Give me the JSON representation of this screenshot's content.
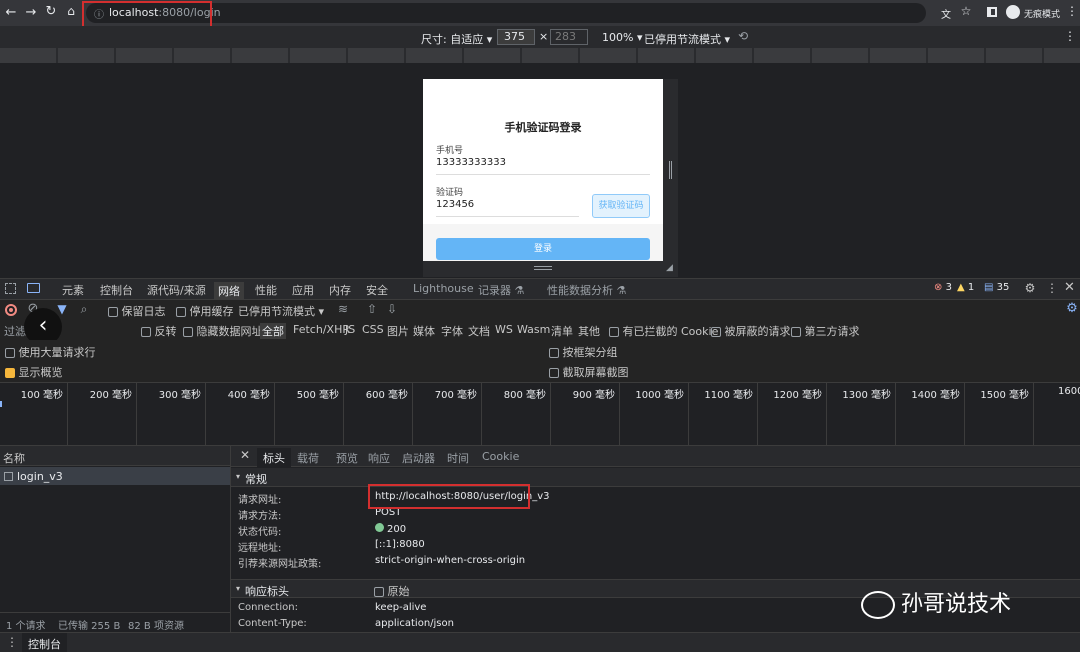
{
  "browser": {
    "url_host": "localhost",
    "url_rest": ":8080/login",
    "profile_label": "无痕模式"
  },
  "device_toolbar": {
    "size_label": "尺寸: 自适应 ▾",
    "width": "375",
    "x": "×",
    "height": "283",
    "zoom": "100% ▾",
    "throttle": "已停用节流模式 ▾"
  },
  "phone": {
    "title": "手机验证码登录",
    "phone_label": "手机号",
    "phone_value": "13333333333",
    "code_label": "验证码",
    "code_value": "123456",
    "code_button": "获取验证码",
    "login_button": "登录"
  },
  "devtools": {
    "tabs": [
      "元素",
      "控制台",
      "源代码/来源",
      "网络",
      "性能",
      "应用",
      "内存",
      "安全",
      "Lighthouse",
      "记录器 ⚗",
      "性能数据分析 ⚗"
    ],
    "active_tab": "网络",
    "errors": "3",
    "warnings": "1",
    "messages": "35"
  },
  "network_toolbar": {
    "preserve_log": "保留日志",
    "disable_cache": "停用缓存",
    "throttle": "已停用节流模式"
  },
  "filter": {
    "placeholder": "过滤",
    "invert": "反转",
    "hide_data": "隐藏数据网址",
    "types": [
      "全部",
      "Fetch/XHR",
      "JS",
      "CSS",
      "图片",
      "媒体",
      "字体",
      "文档",
      "WS",
      "Wasm",
      "清单",
      "其他"
    ],
    "blocked_cookies": "有已拦截的 Cookie",
    "blocked_requests": "被屏蔽的请求",
    "third_party": "第三方请求"
  },
  "options": {
    "big_rows": "使用大量请求行",
    "group_by_frame": "按框架分组",
    "overview": "显示概览",
    "screenshots": "截取屏幕截图"
  },
  "timeline": {
    "ticks": [
      "100 毫秒",
      "200 毫秒",
      "300 毫秒",
      "400 毫秒",
      "500 毫秒",
      "600 毫秒",
      "700 毫秒",
      "800 毫秒",
      "900 毫秒",
      "1000 毫秒",
      "1100 毫秒",
      "1200 毫秒",
      "1300 毫秒",
      "1400 毫秒",
      "1500 毫秒",
      "1600"
    ]
  },
  "request_list": {
    "header": "名称",
    "item": "login_v3",
    "summary_requests": "1 个请求",
    "summary_transferred": "已传输 255 B",
    "summary_resources": "82 B 项资源"
  },
  "details": {
    "tabs": [
      "标头",
      "载荷",
      "预览",
      "响应",
      "启动器",
      "时间",
      "Cookie"
    ],
    "active_tab": "标头",
    "general_title": "常规",
    "general": [
      {
        "label": "请求网址:",
        "value": "http://localhost:8080/user/login_v3"
      },
      {
        "label": "请求方法:",
        "value": "POST"
      },
      {
        "label": "状态代码:",
        "value": "200"
      },
      {
        "label": "远程地址:",
        "value": "[::1]:8080"
      },
      {
        "label": "引荐来源网址政策:",
        "value": "strict-origin-when-cross-origin"
      }
    ],
    "response_title": "响应标头",
    "raw": "原始",
    "response": [
      {
        "label": "Connection:",
        "value": "keep-alive"
      },
      {
        "label": "Content-Type:",
        "value": "application/json"
      }
    ]
  },
  "console_tab": "控制台",
  "watermark": "孙哥说技术",
  "colors": {
    "accent": "#8ab4f8",
    "error": "#d32f2f",
    "status_ok": "#81c995",
    "button_blue": "#64b5f6"
  }
}
